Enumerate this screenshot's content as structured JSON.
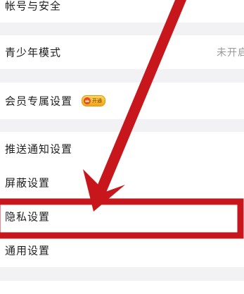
{
  "settings": {
    "account_security": "帐号与安全",
    "teen_mode": {
      "label": "青少年模式",
      "value": "未开启"
    },
    "member_settings": {
      "label": "会员专属设置",
      "badge": "开通"
    },
    "push_notifications": "推送通知设置",
    "block_settings": "屏蔽设置",
    "privacy_settings": "隐私设置",
    "general_settings": "通用设置"
  },
  "annotation": {
    "color": "#c8171c",
    "highlighted_item": "隐私设置"
  }
}
